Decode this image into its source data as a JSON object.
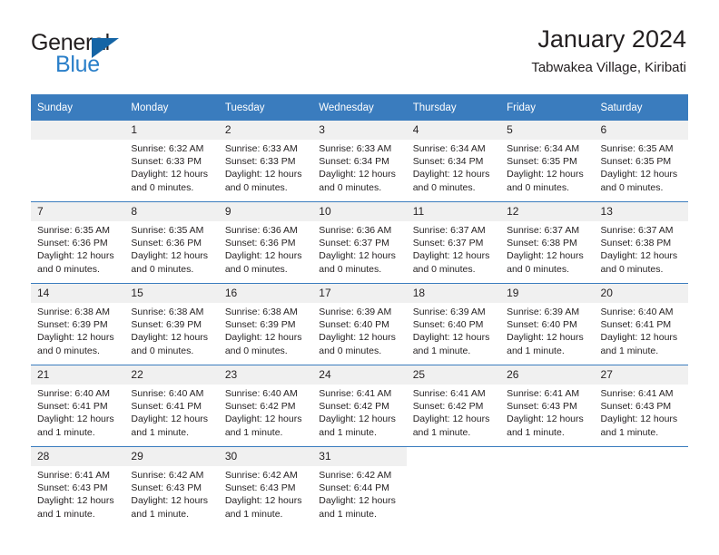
{
  "brand": {
    "name_top": "General",
    "name_bottom": "Blue",
    "flag_icon": "triangle-flag-icon",
    "accent_color": "#2a7fc9",
    "flag_color": "#1464a5"
  },
  "header": {
    "title": "January 2024",
    "subtitle": "Tabwakea Village, Kiribati",
    "header_bg_color": "#3a7cbe",
    "daynum_bg_color": "#f0f0f0"
  },
  "weekday_headers": [
    "Sunday",
    "Monday",
    "Tuesday",
    "Wednesday",
    "Thursday",
    "Friday",
    "Saturday"
  ],
  "weeks": [
    [
      {
        "day": "",
        "empty": true,
        "lines": []
      },
      {
        "day": "1",
        "lines": [
          "Sunrise: 6:32 AM",
          "Sunset: 6:33 PM",
          "Daylight: 12 hours",
          "and 0 minutes."
        ]
      },
      {
        "day": "2",
        "lines": [
          "Sunrise: 6:33 AM",
          "Sunset: 6:33 PM",
          "Daylight: 12 hours",
          "and 0 minutes."
        ]
      },
      {
        "day": "3",
        "lines": [
          "Sunrise: 6:33 AM",
          "Sunset: 6:34 PM",
          "Daylight: 12 hours",
          "and 0 minutes."
        ]
      },
      {
        "day": "4",
        "lines": [
          "Sunrise: 6:34 AM",
          "Sunset: 6:34 PM",
          "Daylight: 12 hours",
          "and 0 minutes."
        ]
      },
      {
        "day": "5",
        "lines": [
          "Sunrise: 6:34 AM",
          "Sunset: 6:35 PM",
          "Daylight: 12 hours",
          "and 0 minutes."
        ]
      },
      {
        "day": "6",
        "lines": [
          "Sunrise: 6:35 AM",
          "Sunset: 6:35 PM",
          "Daylight: 12 hours",
          "and 0 minutes."
        ]
      }
    ],
    [
      {
        "day": "7",
        "lines": [
          "Sunrise: 6:35 AM",
          "Sunset: 6:36 PM",
          "Daylight: 12 hours",
          "and 0 minutes."
        ]
      },
      {
        "day": "8",
        "lines": [
          "Sunrise: 6:35 AM",
          "Sunset: 6:36 PM",
          "Daylight: 12 hours",
          "and 0 minutes."
        ]
      },
      {
        "day": "9",
        "lines": [
          "Sunrise: 6:36 AM",
          "Sunset: 6:36 PM",
          "Daylight: 12 hours",
          "and 0 minutes."
        ]
      },
      {
        "day": "10",
        "lines": [
          "Sunrise: 6:36 AM",
          "Sunset: 6:37 PM",
          "Daylight: 12 hours",
          "and 0 minutes."
        ]
      },
      {
        "day": "11",
        "lines": [
          "Sunrise: 6:37 AM",
          "Sunset: 6:37 PM",
          "Daylight: 12 hours",
          "and 0 minutes."
        ]
      },
      {
        "day": "12",
        "lines": [
          "Sunrise: 6:37 AM",
          "Sunset: 6:38 PM",
          "Daylight: 12 hours",
          "and 0 minutes."
        ]
      },
      {
        "day": "13",
        "lines": [
          "Sunrise: 6:37 AM",
          "Sunset: 6:38 PM",
          "Daylight: 12 hours",
          "and 0 minutes."
        ]
      }
    ],
    [
      {
        "day": "14",
        "lines": [
          "Sunrise: 6:38 AM",
          "Sunset: 6:39 PM",
          "Daylight: 12 hours",
          "and 0 minutes."
        ]
      },
      {
        "day": "15",
        "lines": [
          "Sunrise: 6:38 AM",
          "Sunset: 6:39 PM",
          "Daylight: 12 hours",
          "and 0 minutes."
        ]
      },
      {
        "day": "16",
        "lines": [
          "Sunrise: 6:38 AM",
          "Sunset: 6:39 PM",
          "Daylight: 12 hours",
          "and 0 minutes."
        ]
      },
      {
        "day": "17",
        "lines": [
          "Sunrise: 6:39 AM",
          "Sunset: 6:40 PM",
          "Daylight: 12 hours",
          "and 0 minutes."
        ]
      },
      {
        "day": "18",
        "lines": [
          "Sunrise: 6:39 AM",
          "Sunset: 6:40 PM",
          "Daylight: 12 hours",
          "and 1 minute."
        ]
      },
      {
        "day": "19",
        "lines": [
          "Sunrise: 6:39 AM",
          "Sunset: 6:40 PM",
          "Daylight: 12 hours",
          "and 1 minute."
        ]
      },
      {
        "day": "20",
        "lines": [
          "Sunrise: 6:40 AM",
          "Sunset: 6:41 PM",
          "Daylight: 12 hours",
          "and 1 minute."
        ]
      }
    ],
    [
      {
        "day": "21",
        "lines": [
          "Sunrise: 6:40 AM",
          "Sunset: 6:41 PM",
          "Daylight: 12 hours",
          "and 1 minute."
        ]
      },
      {
        "day": "22",
        "lines": [
          "Sunrise: 6:40 AM",
          "Sunset: 6:41 PM",
          "Daylight: 12 hours",
          "and 1 minute."
        ]
      },
      {
        "day": "23",
        "lines": [
          "Sunrise: 6:40 AM",
          "Sunset: 6:42 PM",
          "Daylight: 12 hours",
          "and 1 minute."
        ]
      },
      {
        "day": "24",
        "lines": [
          "Sunrise: 6:41 AM",
          "Sunset: 6:42 PM",
          "Daylight: 12 hours",
          "and 1 minute."
        ]
      },
      {
        "day": "25",
        "lines": [
          "Sunrise: 6:41 AM",
          "Sunset: 6:42 PM",
          "Daylight: 12 hours",
          "and 1 minute."
        ]
      },
      {
        "day": "26",
        "lines": [
          "Sunrise: 6:41 AM",
          "Sunset: 6:43 PM",
          "Daylight: 12 hours",
          "and 1 minute."
        ]
      },
      {
        "day": "27",
        "lines": [
          "Sunrise: 6:41 AM",
          "Sunset: 6:43 PM",
          "Daylight: 12 hours",
          "and 1 minute."
        ]
      }
    ],
    [
      {
        "day": "28",
        "lines": [
          "Sunrise: 6:41 AM",
          "Sunset: 6:43 PM",
          "Daylight: 12 hours",
          "and 1 minute."
        ]
      },
      {
        "day": "29",
        "lines": [
          "Sunrise: 6:42 AM",
          "Sunset: 6:43 PM",
          "Daylight: 12 hours",
          "and 1 minute."
        ]
      },
      {
        "day": "30",
        "lines": [
          "Sunrise: 6:42 AM",
          "Sunset: 6:43 PM",
          "Daylight: 12 hours",
          "and 1 minute."
        ]
      },
      {
        "day": "31",
        "lines": [
          "Sunrise: 6:42 AM",
          "Sunset: 6:44 PM",
          "Daylight: 12 hours",
          "and 1 minute."
        ]
      },
      {
        "day": "",
        "blank": true,
        "lines": []
      },
      {
        "day": "",
        "blank": true,
        "lines": []
      },
      {
        "day": "",
        "blank": true,
        "lines": []
      }
    ]
  ]
}
